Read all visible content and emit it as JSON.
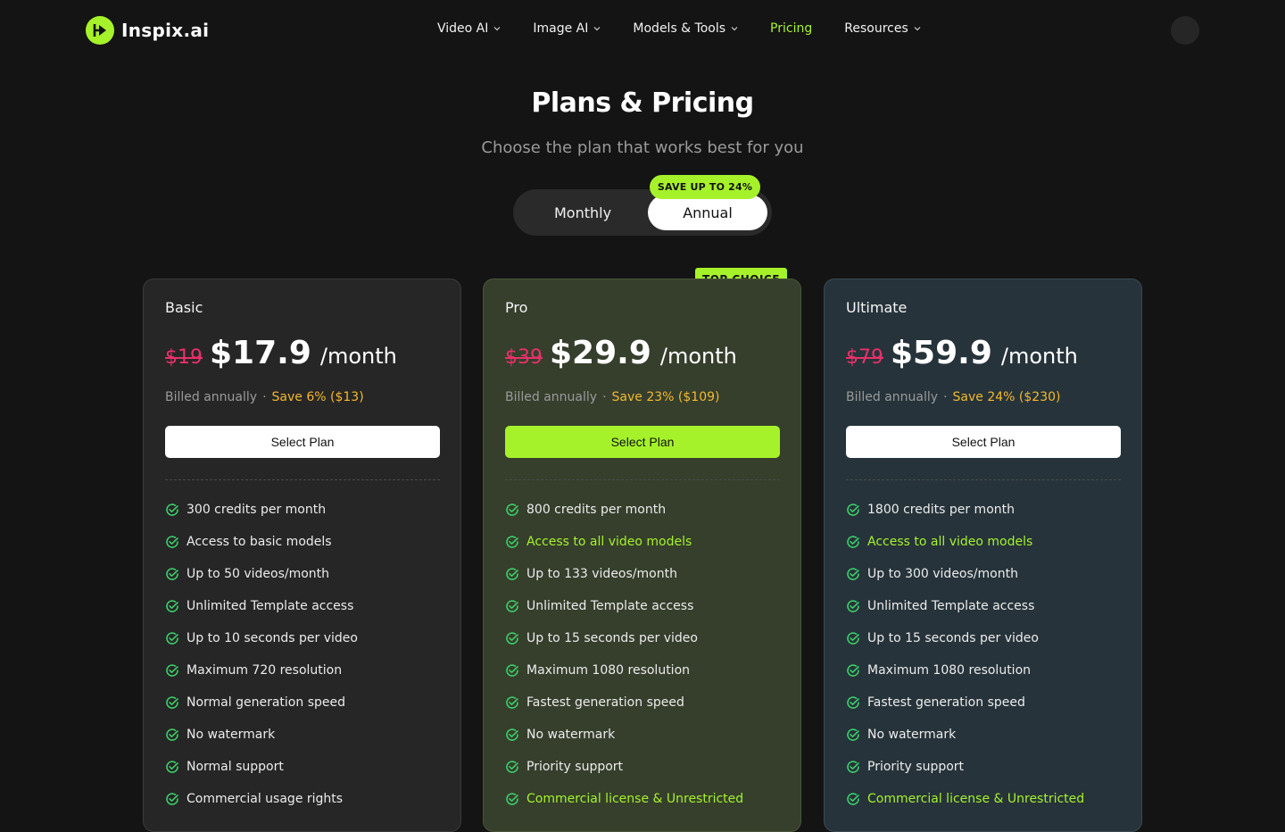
{
  "header": {
    "brand": "Inspix.ai",
    "nav": [
      {
        "label": "Video AI",
        "has_dropdown": true
      },
      {
        "label": "Image AI",
        "has_dropdown": true
      },
      {
        "label": "Models & Tools",
        "has_dropdown": true
      },
      {
        "label": "Pricing",
        "active": true
      },
      {
        "label": "Resources",
        "has_dropdown": true
      }
    ]
  },
  "hero": {
    "title": "Plans & Pricing",
    "subtitle": "Choose the plan that works best for you"
  },
  "billing_toggle": {
    "monthly_label": "Monthly",
    "annual_label": "Annual",
    "selected": "Annual",
    "badge": "SAVE UP TO 24%"
  },
  "plans": [
    {
      "name": "Basic",
      "old_price": "$19",
      "price": "$17.9",
      "period": "/month",
      "billing": "Billed annually",
      "dot": "·",
      "save": "Save 6% ($13)",
      "cta": "Select Plan",
      "features": [
        {
          "text": "300 credits per month"
        },
        {
          "text": "Access to basic models"
        },
        {
          "text": "Up to 50 videos/month"
        },
        {
          "text": "Unlimited Template access"
        },
        {
          "text": "Up to 10 seconds per video"
        },
        {
          "text": "Maximum 720 resolution"
        },
        {
          "text": "Normal generation speed"
        },
        {
          "text": "No watermark"
        },
        {
          "text": "Normal support"
        },
        {
          "text": "Commercial usage rights"
        }
      ]
    },
    {
      "name": "Pro",
      "badge": "TOP CHOICE",
      "old_price": "$39",
      "price": "$29.9",
      "period": "/month",
      "billing": "Billed annually",
      "dot": "·",
      "save": "Save 23% ($109)",
      "cta": "Select Plan",
      "features": [
        {
          "text": "800 credits per month"
        },
        {
          "text": "Access to all video models",
          "highlight": true
        },
        {
          "text": "Up to 133 videos/month"
        },
        {
          "text": "Unlimited Template access"
        },
        {
          "text": "Up to 15 seconds per video"
        },
        {
          "text": "Maximum 1080 resolution"
        },
        {
          "text": "Fastest generation speed"
        },
        {
          "text": "No watermark"
        },
        {
          "text": "Priority support"
        },
        {
          "text": "Commercial license & Unrestricted",
          "highlight": true
        }
      ]
    },
    {
      "name": "Ultimate",
      "old_price": "$79",
      "price": "$59.9",
      "period": "/month",
      "billing": "Billed annually",
      "dot": "·",
      "save": "Save 24% ($230)",
      "cta": "Select Plan",
      "features": [
        {
          "text": "1800 credits per month"
        },
        {
          "text": "Access to all video models",
          "highlight": true
        },
        {
          "text": "Up to 300 videos/month"
        },
        {
          "text": "Unlimited Template access"
        },
        {
          "text": "Up to 15 seconds per video"
        },
        {
          "text": "Maximum 1080 resolution"
        },
        {
          "text": "Fastest generation speed"
        },
        {
          "text": "No watermark"
        },
        {
          "text": "Priority support"
        },
        {
          "text": "Commercial license & Unrestricted",
          "highlight": true
        }
      ]
    }
  ],
  "colors": {
    "accent": "#a6f22a",
    "strike": "#e8306a",
    "save": "#f5b82e",
    "check": "#3ccf6a"
  }
}
